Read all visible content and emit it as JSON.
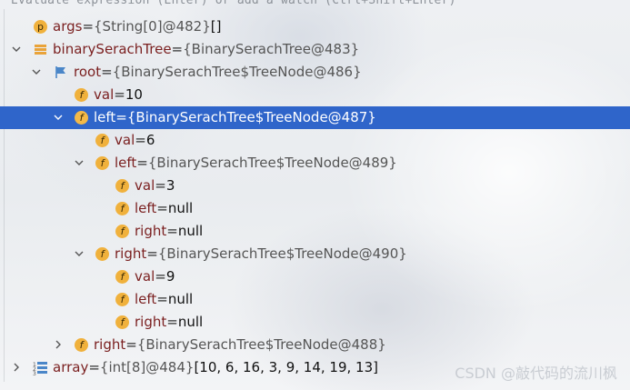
{
  "prompt_text": "Evaluate expression (Enter) or add a watch (Ctrl+Shift+Enter)",
  "watermark": "CSDN @敲代码的流川枫",
  "rows": [
    {
      "name": "args",
      "eq": " = ",
      "value": "{String[0]@482}",
      "extra": " []"
    },
    {
      "name": "binarySerachTree",
      "eq": " = ",
      "value": "{BinarySerachTree@483}"
    },
    {
      "name": "root",
      "eq": " = ",
      "value": "{BinarySerachTree$TreeNode@486}"
    },
    {
      "name": "val",
      "eq": " = ",
      "value": "10"
    },
    {
      "name": "left",
      "eq": " = ",
      "value": "{BinarySerachTree$TreeNode@487}"
    },
    {
      "name": "val",
      "eq": " = ",
      "value": "6"
    },
    {
      "name": "left",
      "eq": " = ",
      "value": "{BinarySerachTree$TreeNode@489}"
    },
    {
      "name": "val",
      "eq": " = ",
      "value": "3"
    },
    {
      "name": "left",
      "eq": " = ",
      "value": "null"
    },
    {
      "name": "right",
      "eq": " = ",
      "value": "null"
    },
    {
      "name": "right",
      "eq": " = ",
      "value": "{BinarySerachTree$TreeNode@490}"
    },
    {
      "name": "val",
      "eq": " = ",
      "value": "9"
    },
    {
      "name": "left",
      "eq": " = ",
      "value": "null"
    },
    {
      "name": "right",
      "eq": " = ",
      "value": "null"
    },
    {
      "name": "right",
      "eq": " = ",
      "value": "{BinarySerachTree$TreeNode@488}"
    },
    {
      "name": "array",
      "eq": " = ",
      "value": "{int[8]@484}",
      "extra": " [10, 6, 16, 3, 9, 14, 19, 13]"
    }
  ],
  "badges": {
    "field": "f",
    "parameter": "p"
  }
}
